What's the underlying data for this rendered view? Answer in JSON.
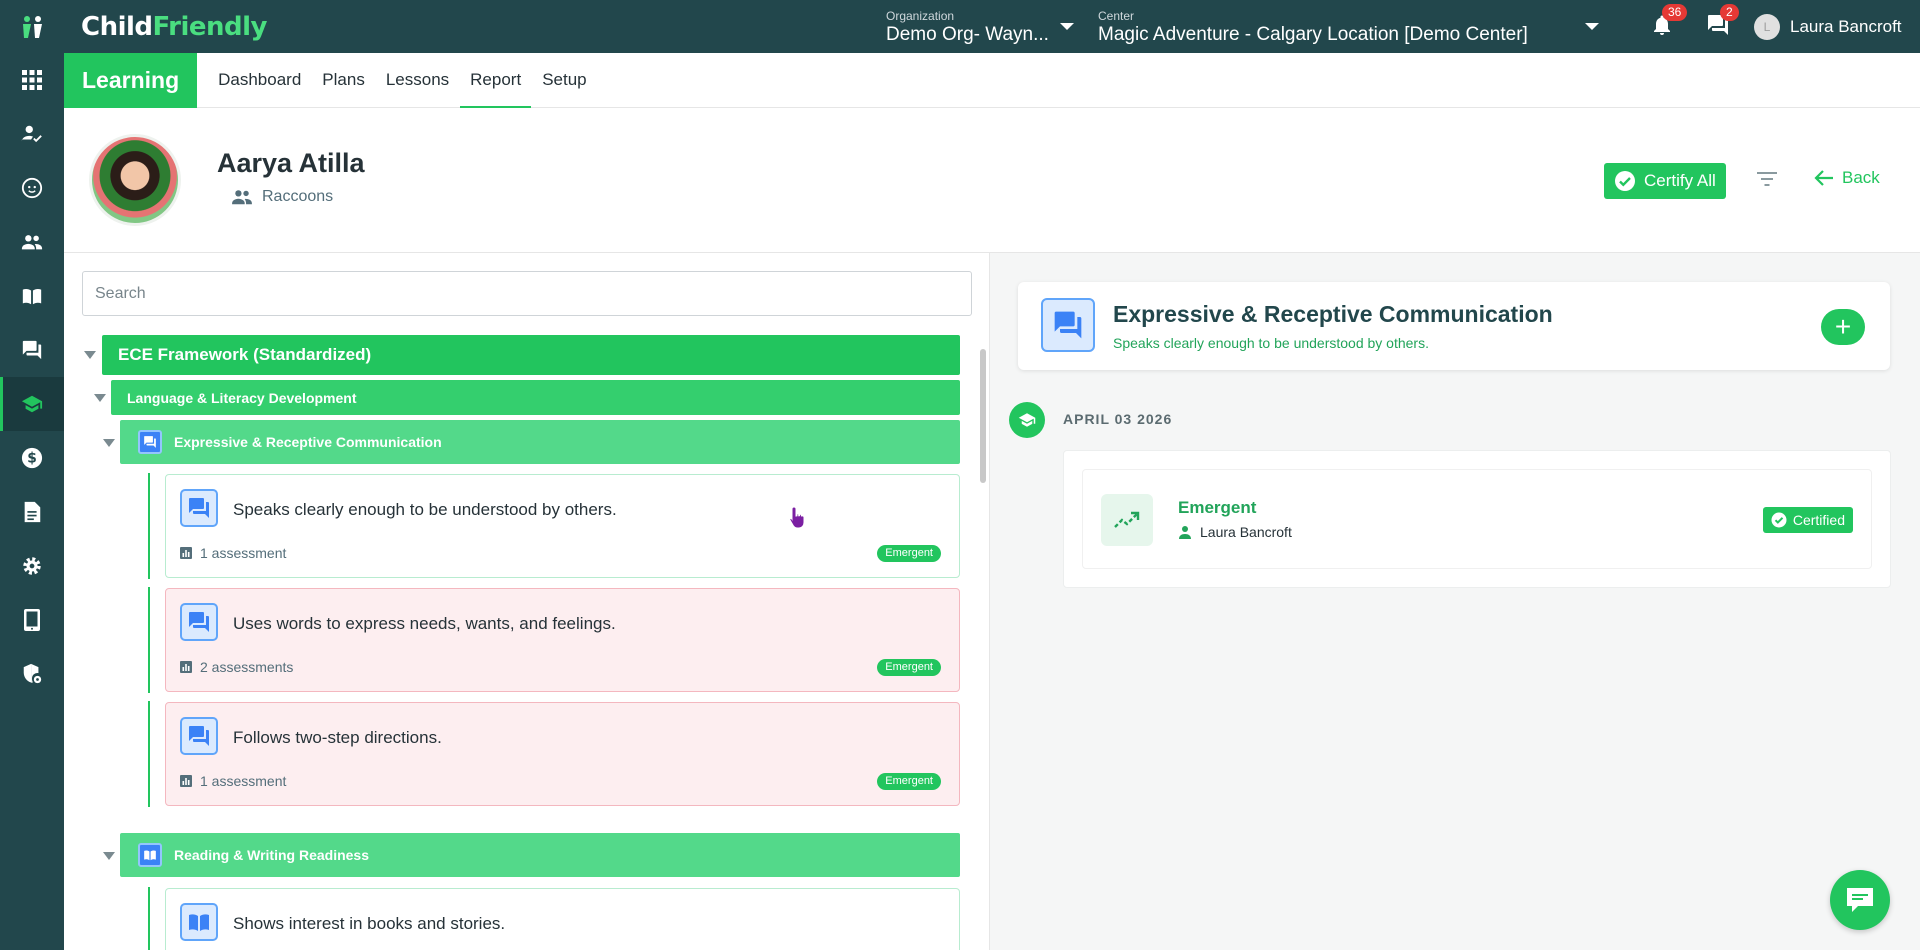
{
  "app": {
    "brand_part1": "Child",
    "brand_part2": "Friendly"
  },
  "topbar": {
    "org_label": "Organization",
    "org_value": "Demo Org- Wayn...",
    "center_label": "Center",
    "center_value": "Magic Adventure - Calgary Location [Demo Center]",
    "notifications_count": "36",
    "messages_count": "2",
    "user_initial": "L",
    "user_name": "Laura Bancroft"
  },
  "sidenav": {
    "items": [
      "apps-icon",
      "check-in-icon",
      "child-face-icon",
      "people-icon",
      "book-icon",
      "chat-icon",
      "learning-cap-icon",
      "billing-dollar-icon",
      "document-icon",
      "settings-gear-icon",
      "tablet-icon",
      "security-icon"
    ],
    "active": "learning-cap-icon"
  },
  "module": {
    "title": "Learning",
    "tabs": [
      {
        "label": "Dashboard"
      },
      {
        "label": "Plans"
      },
      {
        "label": "Lessons"
      },
      {
        "label": "Report",
        "active": true
      },
      {
        "label": "Setup"
      }
    ]
  },
  "profile": {
    "name": "Aarya Atilla",
    "group": "Raccoons",
    "certify_label": "Certify All",
    "back_label": "Back"
  },
  "search": {
    "placeholder": "Search",
    "value": ""
  },
  "tree": {
    "framework": "ECE Framework (Standardized)",
    "domain": "Language & Literacy Development",
    "skill_1": "Expressive & Receptive Communication",
    "indicators": [
      {
        "title": "Speaks clearly enough to be understood by others.",
        "meta": "1 assessment",
        "level": "Emergent",
        "state": "certified"
      },
      {
        "title": "Uses words to express needs, wants, and feelings.",
        "meta": "2 assessments",
        "level": "Emergent",
        "state": "uncertified"
      },
      {
        "title": "Follows two-step directions.",
        "meta": "1 assessment",
        "level": "Emergent",
        "state": "uncertified"
      }
    ],
    "skill_2": "Reading & Writing Readiness",
    "skill_2_indicator": "Shows interest in books and stories."
  },
  "detail": {
    "title": "Expressive & Receptive Communication",
    "subtitle": "Speaks clearly enough to be understood by others.",
    "date": "APRIL 03 2026",
    "entry_level": "Emergent",
    "entry_by": "Laura Bancroft",
    "entry_status": "Certified"
  },
  "colors": {
    "brand_green": "#22c55e",
    "dark_teal": "#22474c",
    "uncertified_bg": "#fdeef0"
  }
}
